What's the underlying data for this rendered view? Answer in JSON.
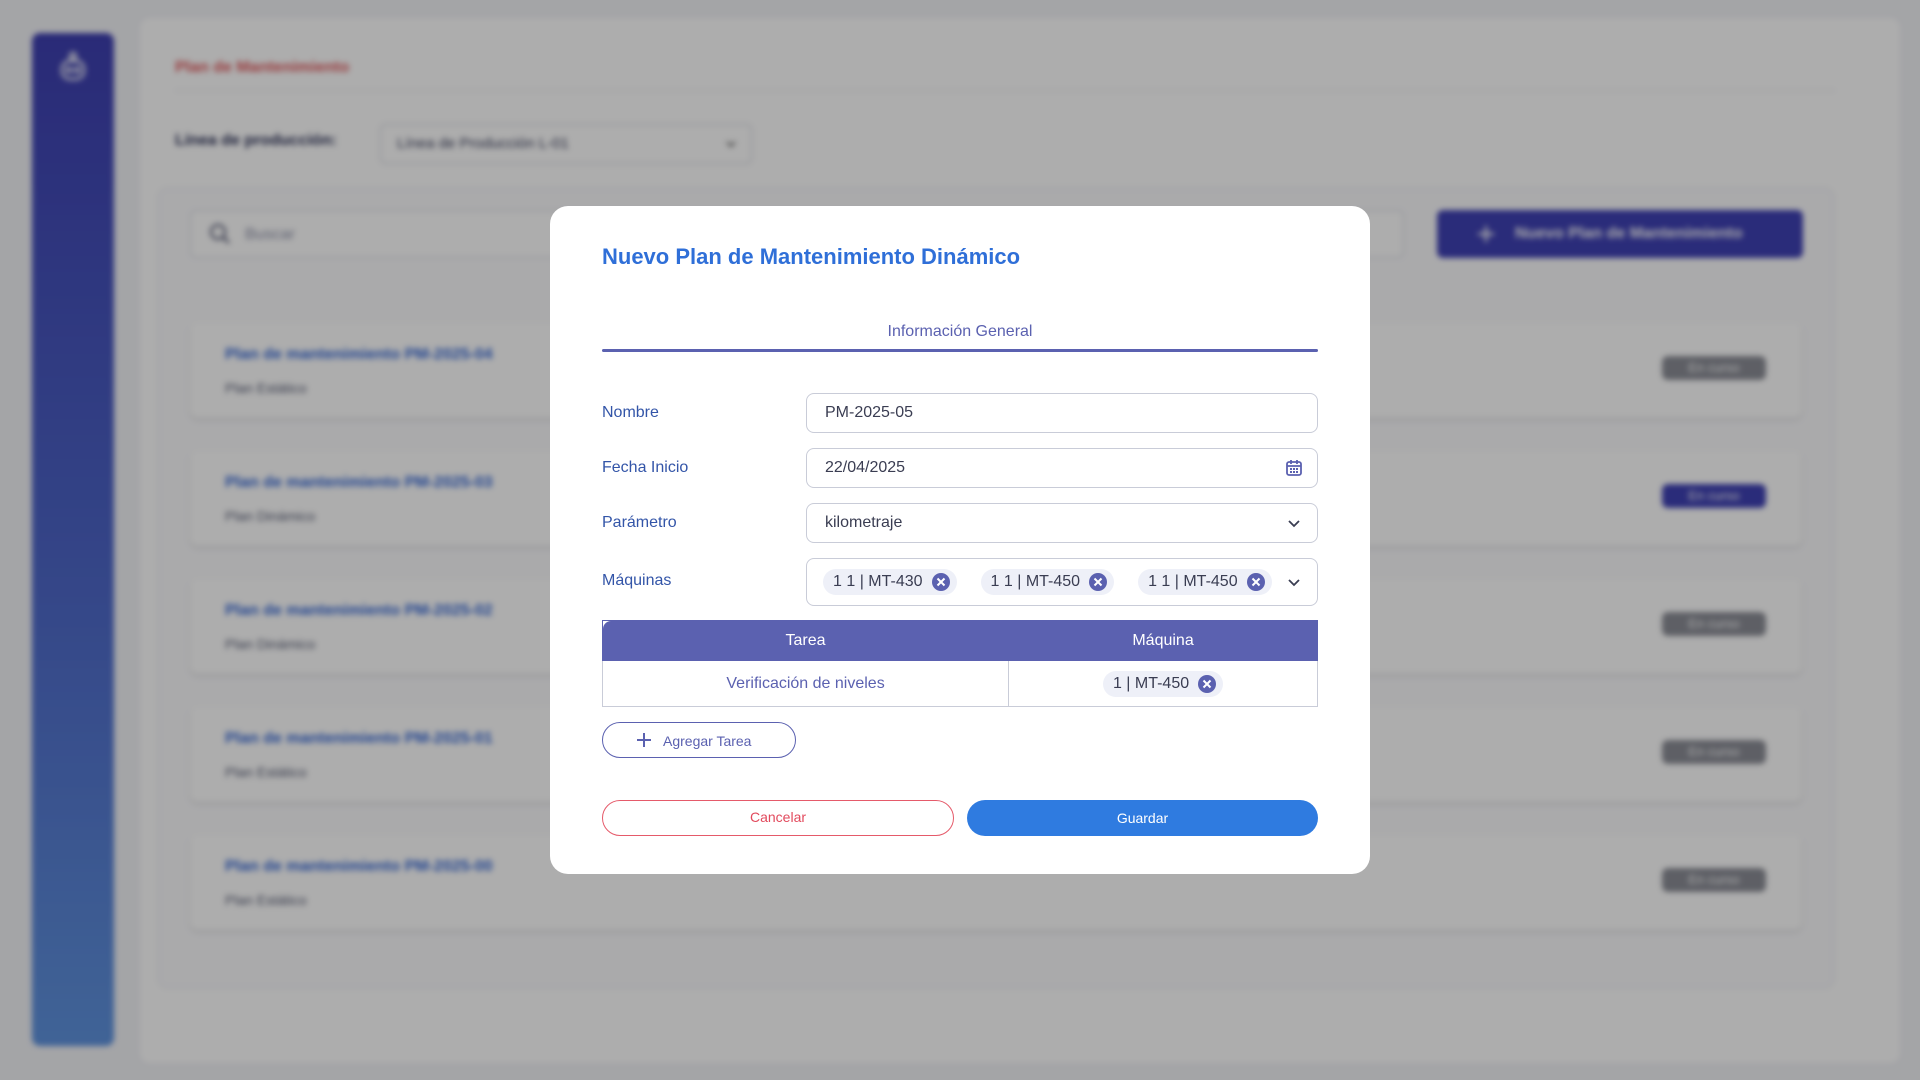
{
  "background": {
    "breadcrumb": "Plan de Mantenimiento",
    "line_label": "Línea de producción:",
    "line_select_value": "Línea de Producción L-01",
    "search_placeholder": "Buscar",
    "new_plan_label": "Nuevo Plan de Mantenimiento",
    "plans": [
      {
        "title": "Plan de mantenimiento PM-2025-04",
        "type": "Plan Estático",
        "status": "En curso",
        "active": false
      },
      {
        "title": "Plan de mantenimiento PM-2025-03",
        "type": "Plan Dinámico",
        "status": "En curso",
        "active": true
      },
      {
        "title": "Plan de mantenimiento PM-2025-02",
        "type": "Plan Dinámico",
        "status": "En curso",
        "active": false
      },
      {
        "title": "Plan de mantenimiento PM-2025-01",
        "type": "Plan Estático",
        "status": "En curso",
        "active": false
      },
      {
        "title": "Plan de mantenimiento PM-2025-00",
        "type": "Plan Estático",
        "status": "En curso",
        "active": false
      }
    ]
  },
  "modal": {
    "title": "Nuevo Plan de Mantenimiento Dinámico",
    "tab_label": "Información General",
    "fields": {
      "nombre": {
        "label": "Nombre",
        "value": "PM-2025-05"
      },
      "fecha": {
        "label": "Fecha Inicio",
        "value": "22/04/2025"
      },
      "parametro": {
        "label": "Parámetro",
        "value": "kilometraje"
      },
      "maquinas": {
        "label": "Máquinas",
        "chips": [
          "1 1 | MT-430",
          "1 1 | MT-450",
          "1 1 | MT-450"
        ]
      }
    },
    "table": {
      "headers": [
        "Tarea",
        "Máquina"
      ],
      "rows": [
        {
          "tarea": "Verificación de niveles",
          "maquina": "1 | MT-450"
        }
      ]
    },
    "add_task_label": "Agregar Tarea",
    "cancel_label": "Cancelar",
    "save_label": "Guardar"
  },
  "colors": {
    "accent": "#5b61b0",
    "title_blue": "#2f6fd8",
    "save_blue": "#2f7be0",
    "cancel_red": "#e24a5d",
    "sidebar_top": "#3e3fb0",
    "sidebar_bottom": "#5f93de"
  },
  "icons": [
    "robot-logo-icon",
    "chevron-down-icon",
    "search-icon",
    "plus-icon",
    "calendar-icon",
    "close-circle-icon"
  ]
}
